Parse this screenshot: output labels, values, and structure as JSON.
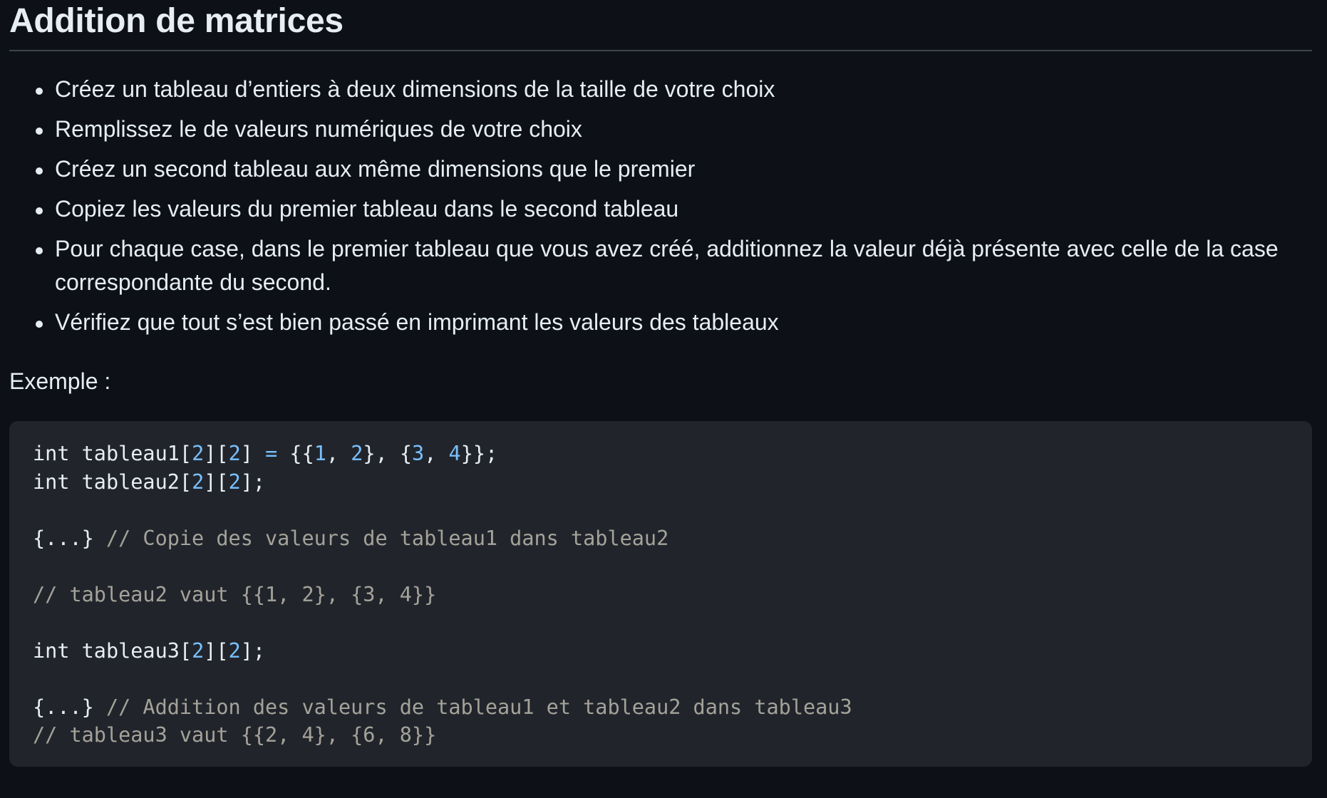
{
  "heading": "Addition de matrices",
  "tasks": [
    "Créez un tableau d’entiers à deux dimensions de la taille de votre choix",
    "Remplissez le de valeurs numériques de votre choix",
    "Créez un second tableau aux même dimensions que le premier",
    "Copiez les valeurs du premier tableau dans le second tableau",
    "Pour chaque case, dans le premier tableau que vous avez créé, additionnez la valeur déjà présente avec celle de la case correspondante du second.",
    "Vérifiez que tout s’est bien passé en imprimant les valeurs des tableaux"
  ],
  "example_label": "Exemple :",
  "code_lines": [
    [
      {
        "t": "int",
        "c": "kw"
      },
      {
        "t": " tableau1["
      },
      {
        "t": "2",
        "c": "num"
      },
      {
        "t": "]["
      },
      {
        "t": "2",
        "c": "num"
      },
      {
        "t": "] "
      },
      {
        "t": "=",
        "c": "op"
      },
      {
        "t": " {{"
      },
      {
        "t": "1",
        "c": "num"
      },
      {
        "t": ", "
      },
      {
        "t": "2",
        "c": "num"
      },
      {
        "t": "}, {"
      },
      {
        "t": "3",
        "c": "num"
      },
      {
        "t": ", "
      },
      {
        "t": "4",
        "c": "num"
      },
      {
        "t": "}};"
      }
    ],
    [
      {
        "t": "int",
        "c": "kw"
      },
      {
        "t": " tableau2["
      },
      {
        "t": "2",
        "c": "num"
      },
      {
        "t": "]["
      },
      {
        "t": "2",
        "c": "num"
      },
      {
        "t": "];"
      }
    ],
    [],
    [
      {
        "t": "{...} "
      },
      {
        "t": "// Copie des valeurs de tableau1 dans tableau2",
        "c": "cm"
      }
    ],
    [],
    [
      {
        "t": "// tableau2 vaut {{1, 2}, {3, 4}}",
        "c": "cm"
      }
    ],
    [],
    [
      {
        "t": "int",
        "c": "kw"
      },
      {
        "t": " tableau3["
      },
      {
        "t": "2",
        "c": "num"
      },
      {
        "t": "]["
      },
      {
        "t": "2",
        "c": "num"
      },
      {
        "t": "];"
      }
    ],
    [],
    [
      {
        "t": "{...} "
      },
      {
        "t": "// Addition des valeurs de tableau1 et tableau2 dans tableau3",
        "c": "cm"
      }
    ],
    [
      {
        "t": "// tableau3 vaut {{2, 4}, {6, 8}}",
        "c": "cm"
      }
    ]
  ]
}
